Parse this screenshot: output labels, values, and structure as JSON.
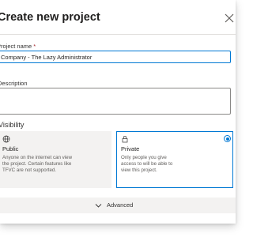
{
  "dialog": {
    "title": "Create new project"
  },
  "form": {
    "project_name_label": "Project name",
    "required_marker": "*",
    "project_name_value": "Company - The Lazy Administrator",
    "description_label": "Description",
    "description_value": ""
  },
  "visibility": {
    "heading": "Visibility",
    "selected": "Private",
    "options": [
      {
        "icon": "globe-icon",
        "title": "Public",
        "description": "Anyone on the internet can view the project. Certain features like TFVC are not supported."
      },
      {
        "icon": "lock-icon",
        "title": "Private",
        "description": "Only people you give access to will be able to view this project."
      }
    ]
  },
  "advanced": {
    "label": "Advanced",
    "icon": "chevron-down-icon"
  },
  "colors": {
    "accent": "#0078d4",
    "required": "#a4262c"
  }
}
